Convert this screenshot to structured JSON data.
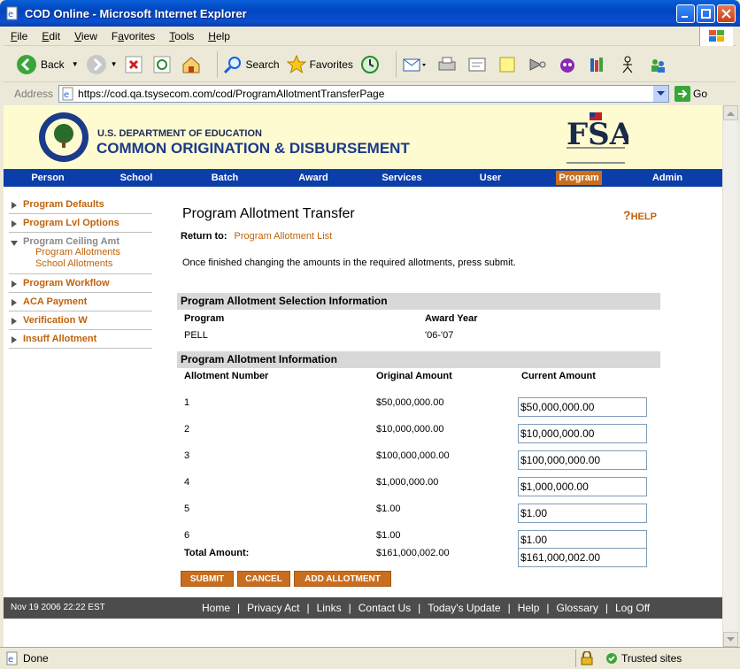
{
  "window": {
    "title": "COD Online - Microsoft Internet Explorer"
  },
  "menu": [
    "File",
    "Edit",
    "View",
    "Favorites",
    "Tools",
    "Help"
  ],
  "menu_ul": [
    "F",
    "E",
    "V",
    "a",
    "T",
    "H"
  ],
  "toolbar": {
    "back": "Back",
    "search": "Search",
    "favorites": "Favorites"
  },
  "address": {
    "label": "Address",
    "url": "https://cod.qa.tsysecom.com/cod/ProgramAllotmentTransferPage",
    "go": "Go"
  },
  "banner": {
    "dept": "U.S. DEPARTMENT OF EDUCATION",
    "cod": "COMMON ORIGINATION & DISBURSEMENT"
  },
  "nav": [
    "Person",
    "School",
    "Batch",
    "Award",
    "Services",
    "User",
    "Program",
    "Admin"
  ],
  "nav_active": "Program",
  "leftnav": {
    "items": [
      {
        "label": "Program Defaults"
      },
      {
        "label": "Program Lvl Options"
      },
      {
        "label": "Program Ceiling Amt",
        "sub": [
          "Program Allotments",
          "School Allotments"
        ]
      },
      {
        "label": "Program Workflow"
      },
      {
        "label": "ACA Payment"
      },
      {
        "label": "Verification W"
      },
      {
        "label": "Insuff Allotment"
      }
    ]
  },
  "page": {
    "title": "Program Allotment Transfer",
    "help": "HELP",
    "return_label": "Return to:",
    "return_link": "Program Allotment List",
    "instructions": "Once finished changing the amounts in the required allotments, press submit."
  },
  "selection": {
    "header": "Program Allotment Selection Information",
    "col_program": "Program",
    "col_award_year": "Award Year",
    "program": "PELL",
    "award_year": "'06-'07"
  },
  "allotment": {
    "header": "Program Allotment Information",
    "col_number": "Allotment Number",
    "col_original": "Original Amount",
    "col_current": "Current Amount",
    "rows": [
      {
        "number": "1",
        "original": "$50,000,000.00",
        "current": "$50,000,000.00"
      },
      {
        "number": "2",
        "original": "$10,000,000.00",
        "current": "$10,000,000.00"
      },
      {
        "number": "3",
        "original": "$100,000,000.00",
        "current": "$100,000,000.00"
      },
      {
        "number": "4",
        "original": "$1,000,000.00",
        "current": "$1,000,000.00"
      },
      {
        "number": "5",
        "original": "$1.00",
        "current": "$1.00"
      },
      {
        "number": "6",
        "original": "$1.00",
        "current": "$1.00"
      }
    ],
    "total_label": "Total Amount:",
    "total_original": "$161,000,002.00",
    "total_current": "$161,000,002.00"
  },
  "buttons": {
    "submit": "SUBMIT",
    "cancel": "CANCEL",
    "add": "ADD ALLOTMENT"
  },
  "footer": {
    "date": "Nov 19 2006 22:22 EST",
    "links": [
      "Home",
      "Privacy Act",
      "Links",
      "Contact Us",
      "Today's Update",
      "Help",
      "Glossary",
      "Log Off"
    ]
  },
  "status": {
    "left": "Done",
    "right": "Trusted sites"
  },
  "colors": {
    "nav_blue": "#0b3ea8",
    "accent_orange": "#c86e1e",
    "banner_yellow": "#fffbd0"
  }
}
